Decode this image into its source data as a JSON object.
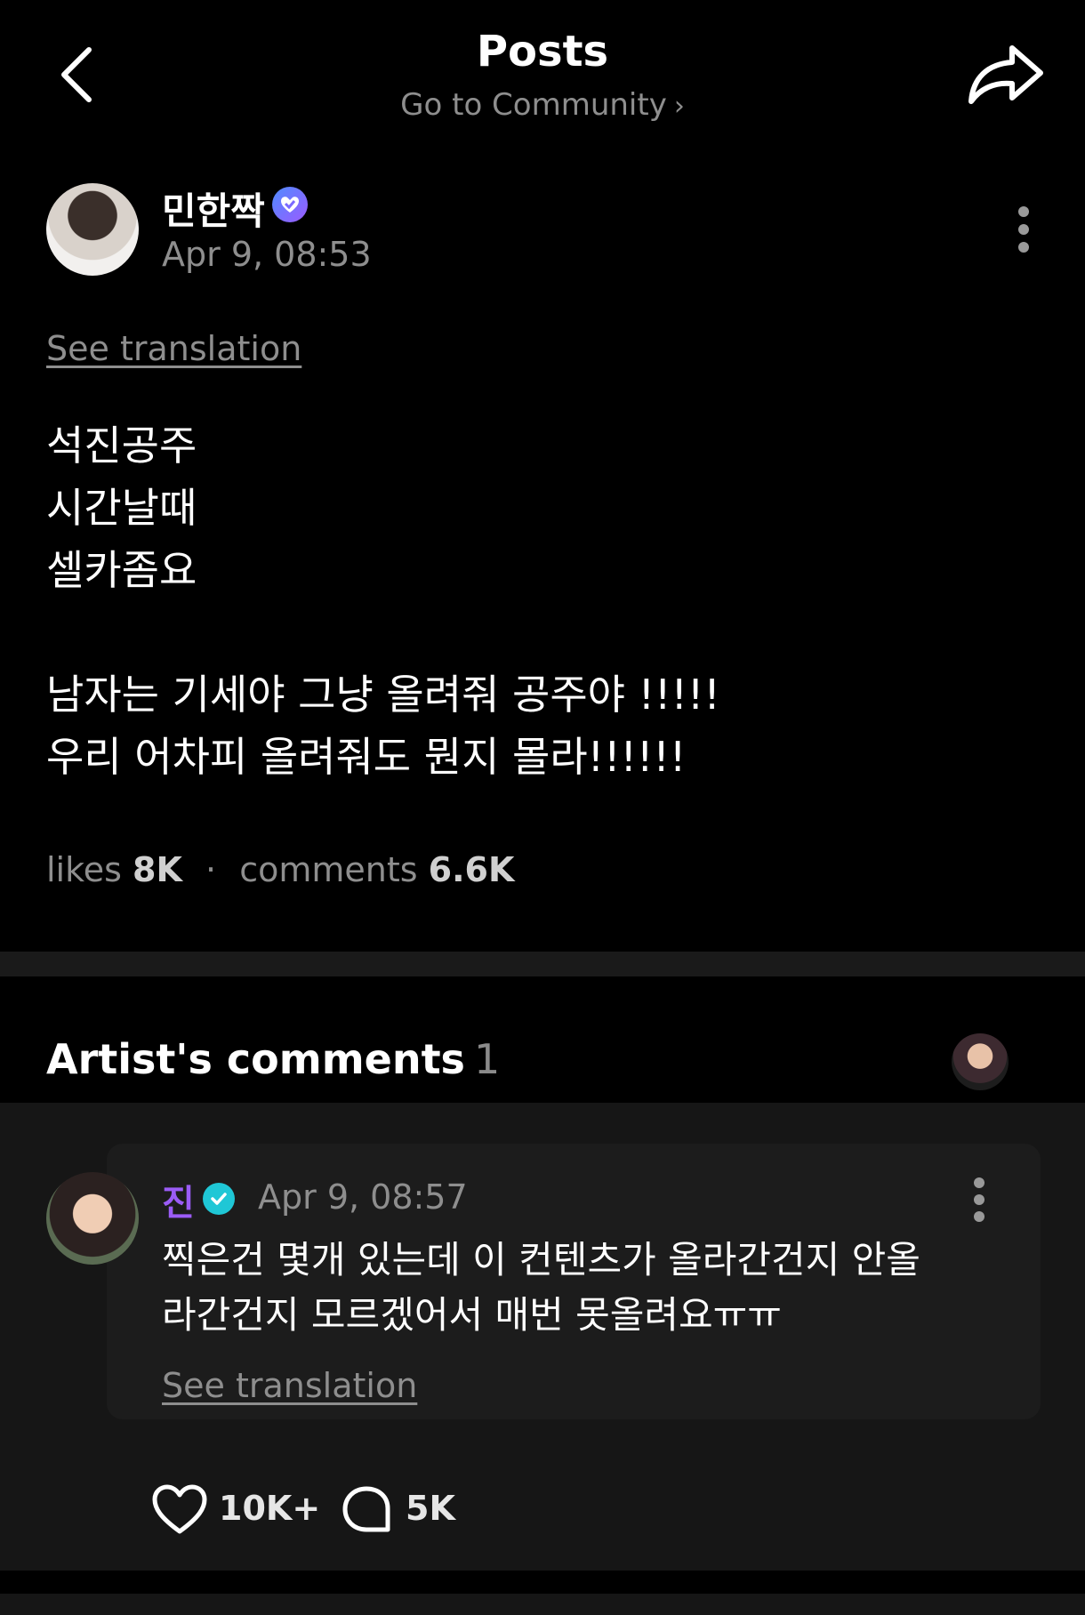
{
  "header": {
    "title": "Posts",
    "subtitle": "Go to Community",
    "subtitle_chevron": "›"
  },
  "post": {
    "author": "민한짝",
    "time": "Apr 9, 08:53",
    "see_translation": "See translation",
    "lines": [
      "석진공주",
      "시간날때",
      "셀카좀요",
      "",
      "남자는 기세야 그냥 올려줘 공주야 !!!!!",
      "우리 어차피 올려줘도 뭔지 몰라!!!!!!"
    ],
    "stats": {
      "likes_label": "likes",
      "likes_value": "8K",
      "separator": "·",
      "comments_label": "comments",
      "comments_value": "6.6K"
    }
  },
  "artist_comments": {
    "title": "Artist's comments",
    "count": "1",
    "comment": {
      "author": "진",
      "time": "Apr 9, 08:57",
      "text_lines": [
        "찍은건 몇개 있는데 이 컨텐츠가 올라간건지 안올",
        "라간건지 모르겠어서 매번 못올려요ㅠㅠ"
      ],
      "see_translation": "See translation",
      "likes": "10K+",
      "replies": "5K"
    }
  },
  "colors": {
    "background": "#000000",
    "muted_text": "#8e8e8e",
    "artist_name": "#9b5cf6",
    "verified_teal": "#1fc7d6",
    "verified_purple": "#7b6bff"
  },
  "icons": {
    "back": "chevron-left-icon",
    "share": "share-arrow-icon",
    "more": "more-vertical-icon",
    "like": "heart-icon",
    "comment": "chat-bubble-icon",
    "verified": "verified-badge-icon"
  }
}
